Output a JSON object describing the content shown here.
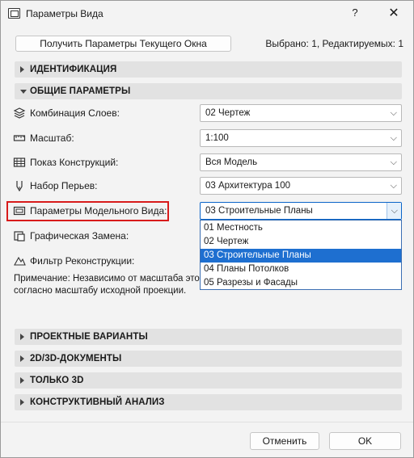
{
  "window": {
    "title": "Параметры Вида",
    "help_label": "?",
    "close_label": "✕"
  },
  "top": {
    "get_params_button": "Получить Параметры Текущего Окна",
    "selection_status": "Выбрано: 1, Редактируемых: 1"
  },
  "sections": {
    "identification": "ИДЕНТИФИКАЦИЯ",
    "general": "ОБЩИЕ ПАРАМЕТРЫ",
    "design_options": "ПРОЕКТНЫЕ ВАРИАНТЫ",
    "docs_2d3d": "2D/3D-ДОКУМЕНТЫ",
    "only_3d": "ТОЛЬКО 3D",
    "structural": "КОНСТРУКТИВНЫЙ АНАЛИЗ"
  },
  "fields": {
    "layer_combination": {
      "label": "Комбинация Слоев:",
      "value": "02 Чертеж",
      "icon": "layers-icon"
    },
    "scale": {
      "label": "Масштаб:",
      "value": "1:100",
      "icon": "scale-icon"
    },
    "structure_display": {
      "label": "Показ Конструкций:",
      "value": "Вся Модель",
      "icon": "structure-icon"
    },
    "pen_set": {
      "label": "Набор Перьев:",
      "value": "03 Архитектура 100",
      "icon": "pen-icon"
    },
    "model_view": {
      "label": "Параметры Модельного Вида:",
      "value": "03 Строительные Планы",
      "icon": "model-view-icon"
    },
    "graphic_override": {
      "label": "Графическая Замена:",
      "icon": "graphic-override-icon"
    },
    "renovation_filter": {
      "label": "Фильтр Реконструкции:",
      "icon": "renovation-filter-icon"
    }
  },
  "dropdown": {
    "options": [
      "01 Местность",
      "02 Чертеж",
      "03 Строительные Планы",
      "04 Планы Потолков",
      "05 Разрезы и Фасады"
    ],
    "selected": "03 Строительные Планы"
  },
  "note": {
    "line1": "Примечание: Независимо от масштаба это",
    "line2": "согласно масштабу исходной проекции."
  },
  "footer": {
    "cancel_button": "Отменить",
    "ok_button": "OK"
  },
  "colors": {
    "highlight_box": "#d81b1b",
    "selection": "#1e6fd0",
    "section_bg": "#e2e2e2"
  }
}
